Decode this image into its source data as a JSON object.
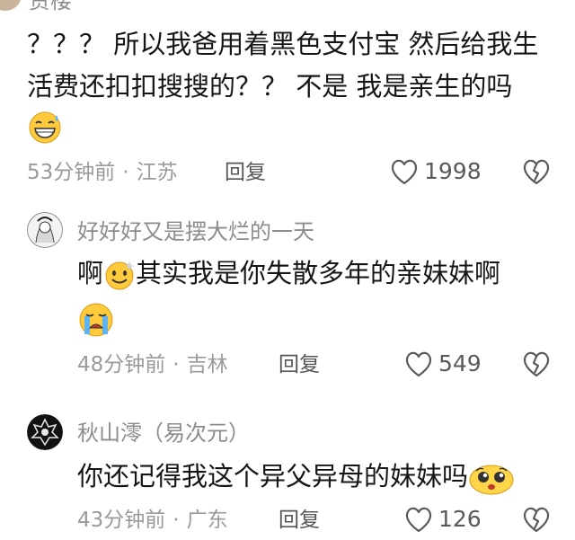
{
  "comments": [
    {
      "username": "贾楼",
      "line1": "？？？ 所以我爸用着黑色支付宝 然后给我生",
      "line2": "活费还扣扣搜搜的？？ 不是 我是亲生的吗",
      "emoji": "grinning-sweat-emoji",
      "time": "53分钟前",
      "location": "江苏",
      "reply_label": "回复",
      "likes": "1998"
    },
    {
      "username": "好好好又是摆大烂的一天",
      "text_before": "啊",
      "text_after": "其实我是你失散多年的亲妹妹啊",
      "emoji_inline": "smile-emoji",
      "emoji": "crying-emoji",
      "time": "48分钟前",
      "location": "吉林",
      "reply_label": "回复",
      "likes": "549"
    },
    {
      "username": "秋山澪（易次元）",
      "text": "你还记得我这个异父异母的妹妹吗",
      "emoji": "pleading-emoji",
      "time": "43分钟前",
      "location": "广东",
      "reply_label": "回复",
      "likes": "126"
    }
  ],
  "colors": {
    "meta_text": "#9a9a9a",
    "username": "#8c8c8c",
    "emoji_yellow": "#ffcb3d"
  }
}
